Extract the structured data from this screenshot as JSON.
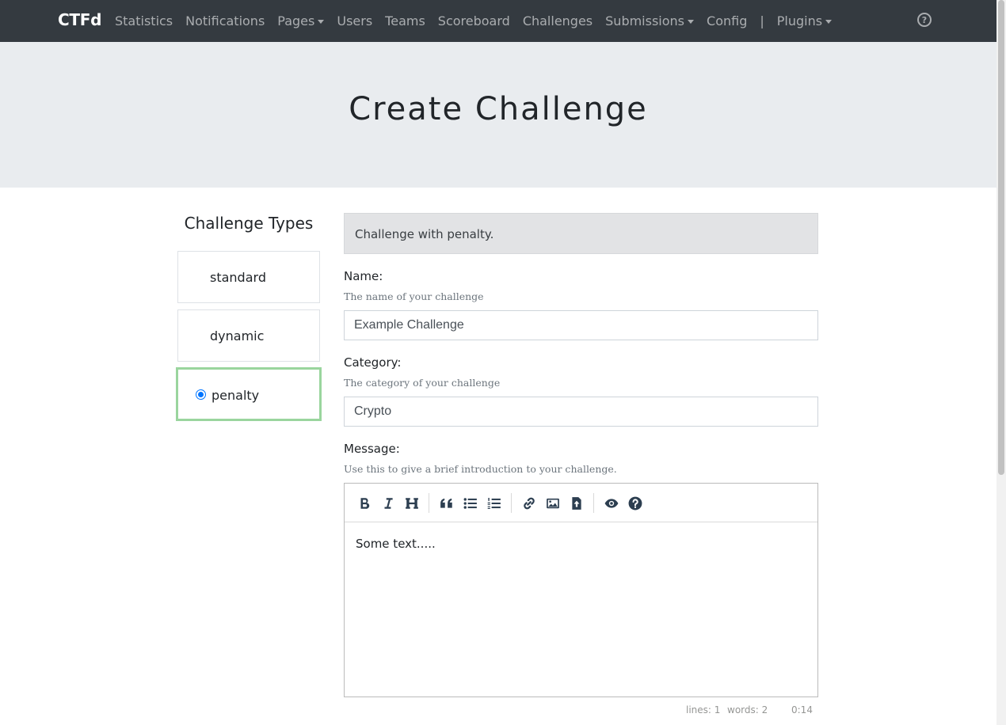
{
  "navbar": {
    "brand": "CTFd",
    "items": [
      {
        "label": "Statistics",
        "dropdown": false
      },
      {
        "label": "Notifications",
        "dropdown": false
      },
      {
        "label": "Pages",
        "dropdown": true
      },
      {
        "label": "Users",
        "dropdown": false
      },
      {
        "label": "Teams",
        "dropdown": false
      },
      {
        "label": "Scoreboard",
        "dropdown": false
      },
      {
        "label": "Challenges",
        "dropdown": false
      },
      {
        "label": "Submissions",
        "dropdown": true
      },
      {
        "label": "Config",
        "dropdown": false
      },
      {
        "label": "|",
        "dropdown": false
      },
      {
        "label": "Plugins",
        "dropdown": true
      }
    ],
    "help_icon": "question-circle-icon",
    "help_glyph": "?"
  },
  "page_title": "Create Challenge",
  "challenge_types": {
    "title": "Challenge Types",
    "items": [
      {
        "label": "standard",
        "selected": false
      },
      {
        "label": "dynamic",
        "selected": false
      },
      {
        "label": "penalty",
        "selected": true
      }
    ]
  },
  "form": {
    "description": "Challenge with penalty.",
    "name": {
      "label": "Name:",
      "help": "The name of your challenge",
      "value": "Example Challenge"
    },
    "category": {
      "label": "Category:",
      "help": "The category of your challenge",
      "value": "Crypto"
    },
    "message": {
      "label": "Message:",
      "help": "Use this to give a brief introduction to your challenge.",
      "content": "Some text.....",
      "toolbar": [
        "bold-icon",
        "italic-icon",
        "heading-icon",
        "quote-icon",
        "unordered-list-icon",
        "ordered-list-icon",
        "link-icon",
        "image-icon",
        "upload-file-icon",
        "preview-eye-icon",
        "guide-question-icon"
      ],
      "status": {
        "lines": "lines: 1",
        "words": "words: 2",
        "cursor": "0:14"
      }
    }
  },
  "colors": {
    "navbar": "#343a40",
    "jumbotron": "#e9ecef",
    "selected_border": "#9ad59e",
    "radio": "#0075ff"
  }
}
